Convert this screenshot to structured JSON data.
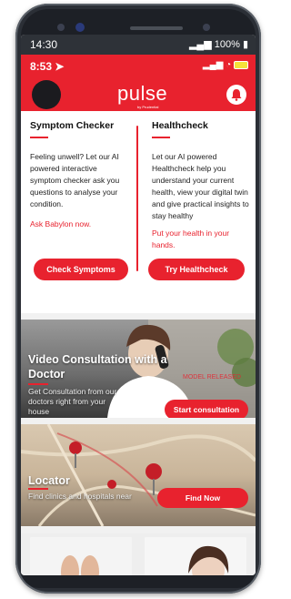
{
  "os_status": {
    "time": "14:30",
    "battery": "100%"
  },
  "header": {
    "time": "8:53",
    "logo": "pulse",
    "logo_sub": "by Prudential"
  },
  "services": [
    {
      "title": "Symptom Checker",
      "description": "Feeling unwell? Let our AI powered interactive symptom checker ask you questions to analyse your condition.",
      "link": "Ask Babylon now.",
      "button": "Check Symptoms"
    },
    {
      "title": "Healthcheck",
      "description": "Let our AI powered Healthcheck help you understand your current health, view your digital twin and give practical insights to stay healthy",
      "link": "Put your health in your hands.",
      "button": "Try Healthcheck"
    }
  ],
  "video_card": {
    "title": "Video Consultation with a Doctor",
    "description": "Get Consultation from our doctors right from your house",
    "watermark": "MODEL RELEASED",
    "button": "Start consultation"
  },
  "locator_card": {
    "title": "Locator",
    "description": "Find clinics and hospitals near",
    "button": "Find Now"
  },
  "colors": {
    "brand": "#e8222e",
    "dark": "#1d2026"
  },
  "icons": [
    "location-arrow-icon",
    "signal-icon",
    "wifi-icon",
    "battery-icon",
    "bell-icon",
    "avatar"
  ]
}
